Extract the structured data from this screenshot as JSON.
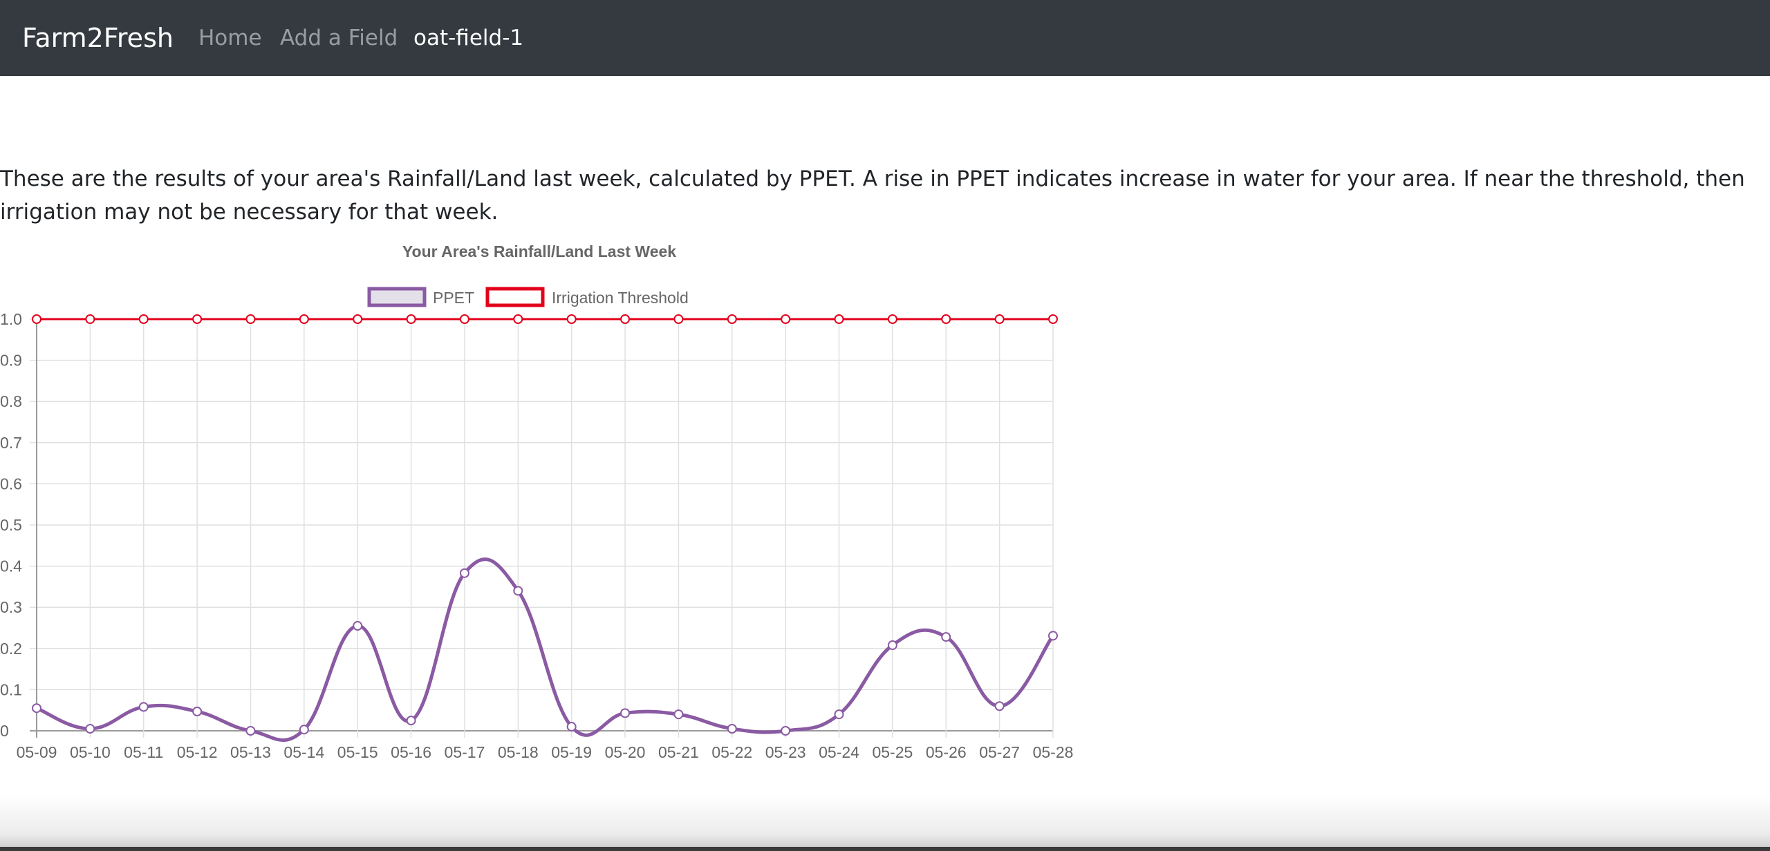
{
  "navbar": {
    "brand": "Farm2Fresh",
    "links": [
      {
        "label": "Home",
        "active": false
      },
      {
        "label": "Add a Field",
        "active": false
      },
      {
        "label": "oat-field-1",
        "active": true
      }
    ]
  },
  "intro": {
    "text": "These are the results of your area's Rainfall/Land last week, calculated by PPET. A rise in PPET indicates increase in water for your area. If near the threshold, then irrigation may not be necessary for that week."
  },
  "chart_data": {
    "type": "line",
    "title": "Your Area's Rainfall/Land Last Week",
    "xlabel": "",
    "ylabel": "",
    "ylim": [
      0,
      1.0
    ],
    "yticks": [
      "0",
      "0.1",
      "0.2",
      "0.3",
      "0.4",
      "0.5",
      "0.6",
      "0.7",
      "0.8",
      "0.9",
      "1.0"
    ],
    "grid": true,
    "legend_position": "top",
    "categories": [
      "05-09",
      "05-10",
      "05-11",
      "05-12",
      "05-13",
      "05-14",
      "05-15",
      "05-16",
      "05-17",
      "05-18",
      "05-19",
      "05-20",
      "05-21",
      "05-22",
      "05-23",
      "05-24",
      "05-25",
      "05-26",
      "05-27",
      "05-28"
    ],
    "series": [
      {
        "name": "PPET",
        "color": "#8a5aa3",
        "fill": "#e4e0ea",
        "values": [
          0.055,
          0.005,
          0.058,
          0.047,
          0.0,
          0.003,
          0.255,
          0.025,
          0.383,
          0.34,
          0.01,
          0.043,
          0.04,
          0.005,
          0.0,
          0.04,
          0.208,
          0.228,
          0.06,
          0.231
        ]
      },
      {
        "name": "Irrigation Threshold",
        "color": "#e3001b",
        "fill": "#ffffff",
        "values": [
          1.0,
          1.0,
          1.0,
          1.0,
          1.0,
          1.0,
          1.0,
          1.0,
          1.0,
          1.0,
          1.0,
          1.0,
          1.0,
          1.0,
          1.0,
          1.0,
          1.0,
          1.0,
          1.0,
          1.0
        ]
      }
    ]
  }
}
